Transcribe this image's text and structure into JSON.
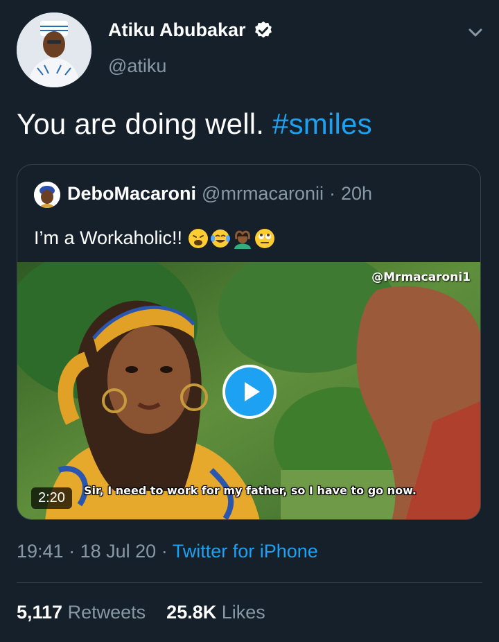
{
  "author": {
    "name": "Atiku Abubakar",
    "handle": "@atiku",
    "verified_icon": "verified-badge-icon"
  },
  "tweet": {
    "text": "You are doing well.",
    "hashtag": "#smiles"
  },
  "quoted_tweet": {
    "name": "DeboMacaroni",
    "handle": "@mrmacaronii",
    "separator": "·",
    "age": "20h",
    "text": "I’m a Workaholic!!",
    "emojis": [
      "weary-face",
      "face-with-tears-of-joy",
      "person-gesturing-ok",
      "face-with-rolling-eyes"
    ],
    "video": {
      "watermark": "@Mrmacaroni1",
      "subtitle": "Sir, I need to work for my father, so I have to go now.",
      "duration": "2:20"
    }
  },
  "meta": {
    "time": "19:41",
    "dot1": "·",
    "date": "18 Jul 20",
    "dot2": "·",
    "source": "Twitter for iPhone"
  },
  "stats": {
    "retweets_count": "5,117",
    "retweets_label": "Retweets",
    "likes_count": "25.8K",
    "likes_label": "Likes"
  },
  "colors": {
    "background": "#15202b",
    "accent": "#1da1f2",
    "secondary_text": "#8899a6",
    "border": "#38444d"
  }
}
